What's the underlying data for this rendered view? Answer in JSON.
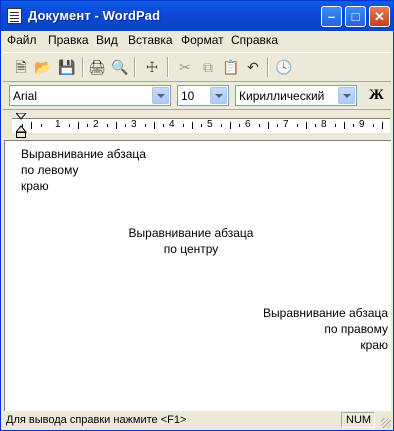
{
  "window": {
    "title": "Документ - WordPad"
  },
  "menu": [
    "Файл",
    "Правка",
    "Вид",
    "Вставка",
    "Формат",
    "Справка"
  ],
  "toolbar": {
    "icons": [
      "new-document",
      "open-folder",
      "save-disk",
      "print",
      "print-preview",
      "find-binoculars",
      "cut-scissors",
      "copy",
      "paste",
      "undo",
      "insert-datetime"
    ]
  },
  "format": {
    "font": "Arial",
    "size": "10",
    "script": "Кириллический",
    "bold_label": "Ж"
  },
  "ruler": {
    "numbers": [
      "1",
      "2",
      "3",
      "4",
      "5",
      "6",
      "7",
      "8",
      "9"
    ]
  },
  "document": {
    "left": [
      "Выравнивание абзаца",
      "по левому",
      "краю"
    ],
    "center": [
      "Выравнивание абзаца",
      "по центру"
    ],
    "right": [
      "Выравнивание абзаца",
      "по правому",
      "краю"
    ]
  },
  "status": {
    "text": "Для вывода справки нажмите <F1>",
    "num": "NUM"
  }
}
